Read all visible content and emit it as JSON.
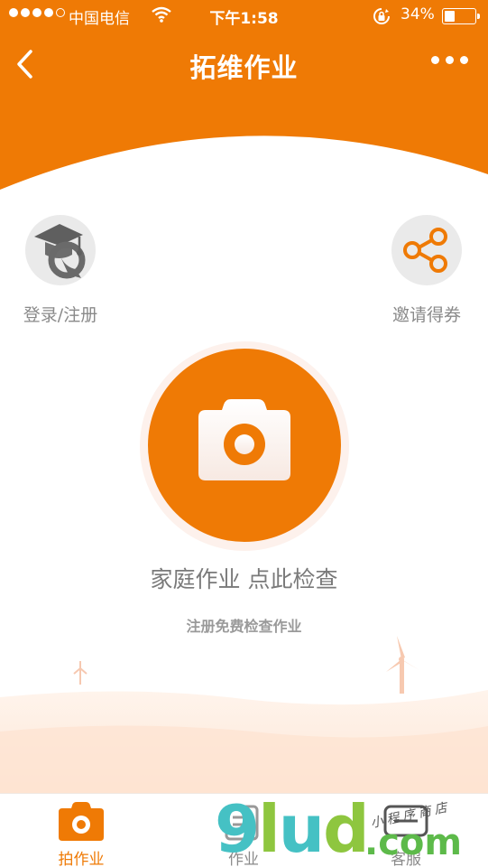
{
  "status_bar": {
    "carrier": "中国电信",
    "time": "下午1:58",
    "battery": "34%",
    "battery_level": 0.34
  },
  "nav": {
    "title": "拓维作业",
    "back_icon": "chevron-left-icon",
    "more_icon": "more-dots-icon"
  },
  "actions": {
    "login_label": "登录/注册",
    "invite_label": "邀请得券"
  },
  "camera": {
    "main_text": "家庭作业 点此检查",
    "sub_text": "注册免费检查作业"
  },
  "tabs": [
    {
      "label": "拍作业",
      "icon": "camera-icon",
      "active": true
    },
    {
      "label": "作业",
      "icon": "homework-icon",
      "active": false
    },
    {
      "label": "客服",
      "icon": "service-icon",
      "active": false
    }
  ],
  "watermark": {
    "text_main": "9lud",
    "text_com": ".com",
    "text_store": "小程序商店"
  },
  "colors": {
    "brand_orange": "#ef7a05",
    "muted_text": "#8a8a8a",
    "circle_bg": "#eaeaea"
  }
}
